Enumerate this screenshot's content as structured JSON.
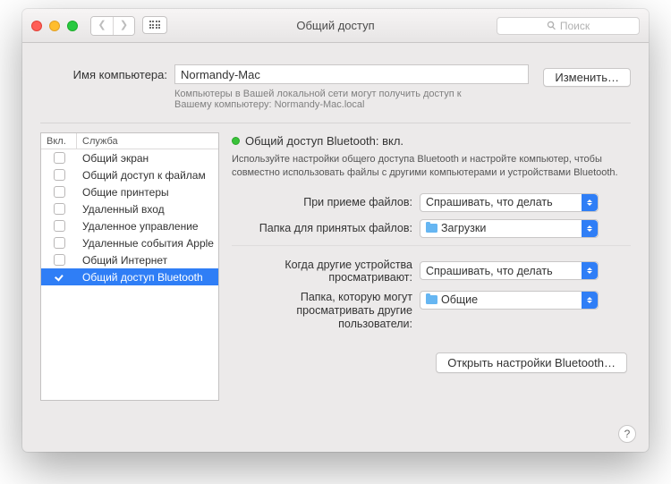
{
  "window": {
    "title": "Общий доступ"
  },
  "search": {
    "placeholder": "Поиск"
  },
  "computer": {
    "label": "Имя компьютера:",
    "value": "Normandy-Mac",
    "help": "Компьютеры в Вашей локальной сети могут получить доступ к Вашему компьютеру: Normandy-Mac.local",
    "change": "Изменить…"
  },
  "list": {
    "col_on": "Вкл.",
    "col_service": "Служба",
    "items": [
      {
        "label": "Общий экран",
        "on": false
      },
      {
        "label": "Общий доступ к файлам",
        "on": false
      },
      {
        "label": "Общие принтеры",
        "on": false
      },
      {
        "label": "Удаленный вход",
        "on": false
      },
      {
        "label": "Удаленное управление",
        "on": false
      },
      {
        "label": "Удаленные события Apple",
        "on": false
      },
      {
        "label": "Общий Интернет",
        "on": false
      },
      {
        "label": "Общий доступ Bluetooth",
        "on": true
      }
    ],
    "selected_index": 7
  },
  "detail": {
    "status_title": "Общий доступ Bluetooth: вкл.",
    "status_help": "Используйте настройки общего доступа Bluetooth и настройте компьютер, чтобы совместно использовать файлы с другими компьютерами и устройствами Bluetooth.",
    "recv_label": "При приеме файлов:",
    "recv_value": "Спрашивать, что делать",
    "folder_label": "Папка для принятых файлов:",
    "folder_value": "Загрузки",
    "browse_label": "Когда другие устройства просматривают:",
    "browse_value": "Спрашивать, что делать",
    "pub_label": "Папка, которую могут просматривать другие пользователи:",
    "pub_value": "Общие",
    "open_bt": "Открыть настройки Bluetooth…"
  },
  "help_button": "?"
}
